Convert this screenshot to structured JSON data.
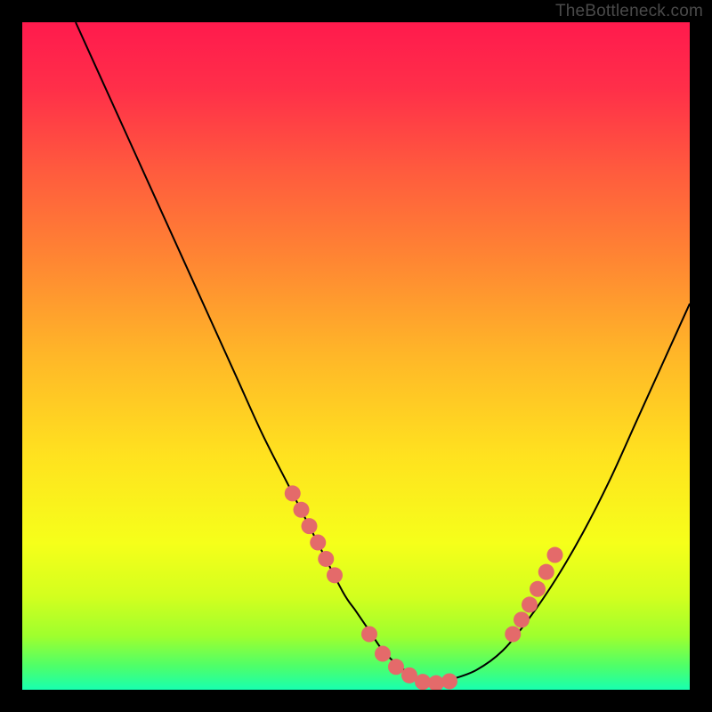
{
  "watermark": "TheBottleneck.com",
  "gradient_stops": [
    {
      "offset": 0.0,
      "color": "#ff1a4d"
    },
    {
      "offset": 0.1,
      "color": "#ff2f49"
    },
    {
      "offset": 0.22,
      "color": "#ff5a3e"
    },
    {
      "offset": 0.35,
      "color": "#ff8433"
    },
    {
      "offset": 0.5,
      "color": "#ffb728"
    },
    {
      "offset": 0.65,
      "color": "#ffe21f"
    },
    {
      "offset": 0.78,
      "color": "#f6ff1a"
    },
    {
      "offset": 0.86,
      "color": "#d3ff1e"
    },
    {
      "offset": 0.92,
      "color": "#9eff2e"
    },
    {
      "offset": 0.965,
      "color": "#4dff6a"
    },
    {
      "offset": 1.0,
      "color": "#18ffb0"
    }
  ],
  "curve_stroke": "#000000",
  "marker_fill": "#e46a6a",
  "marker_stroke": "#b44a4a",
  "marker_radius": 9,
  "chart_data": {
    "type": "line",
    "title": "",
    "xlabel": "",
    "ylabel": "",
    "xlim": [
      0,
      100
    ],
    "ylim": [
      0,
      102
    ],
    "series": [
      {
        "name": "bottleneck-curve",
        "x": [
          8,
          12,
          16,
          20,
          24,
          28,
          32,
          36,
          40,
          44,
          48,
          50,
          52,
          54,
          56,
          58,
          60,
          62,
          64,
          68,
          72,
          76,
          80,
          84,
          88,
          92,
          96,
          100
        ],
        "y": [
          102,
          93,
          84,
          75,
          66,
          57,
          48,
          39,
          31,
          23,
          15,
          12,
          9,
          6,
          4,
          2.5,
          1.5,
          1,
          1.5,
          3,
          6,
          11,
          17,
          24,
          32,
          41,
          50,
          59
        ]
      }
    ],
    "markers_left": {
      "x": [
        40.5,
        41.8,
        43.0,
        44.3,
        45.5,
        46.8
      ],
      "y": [
        30,
        27.5,
        25,
        22.5,
        20,
        17.5
      ]
    },
    "markers_bottom": {
      "x": [
        52,
        54,
        56,
        58,
        60,
        62,
        64
      ],
      "y": [
        8.5,
        5.5,
        3.5,
        2.2,
        1.2,
        1.0,
        1.3
      ]
    },
    "markers_right": {
      "x": [
        73.5,
        74.8,
        76.0,
        77.2,
        78.5,
        79.8
      ],
      "y": [
        8.5,
        10.7,
        13.0,
        15.4,
        18.0,
        20.6
      ]
    }
  }
}
